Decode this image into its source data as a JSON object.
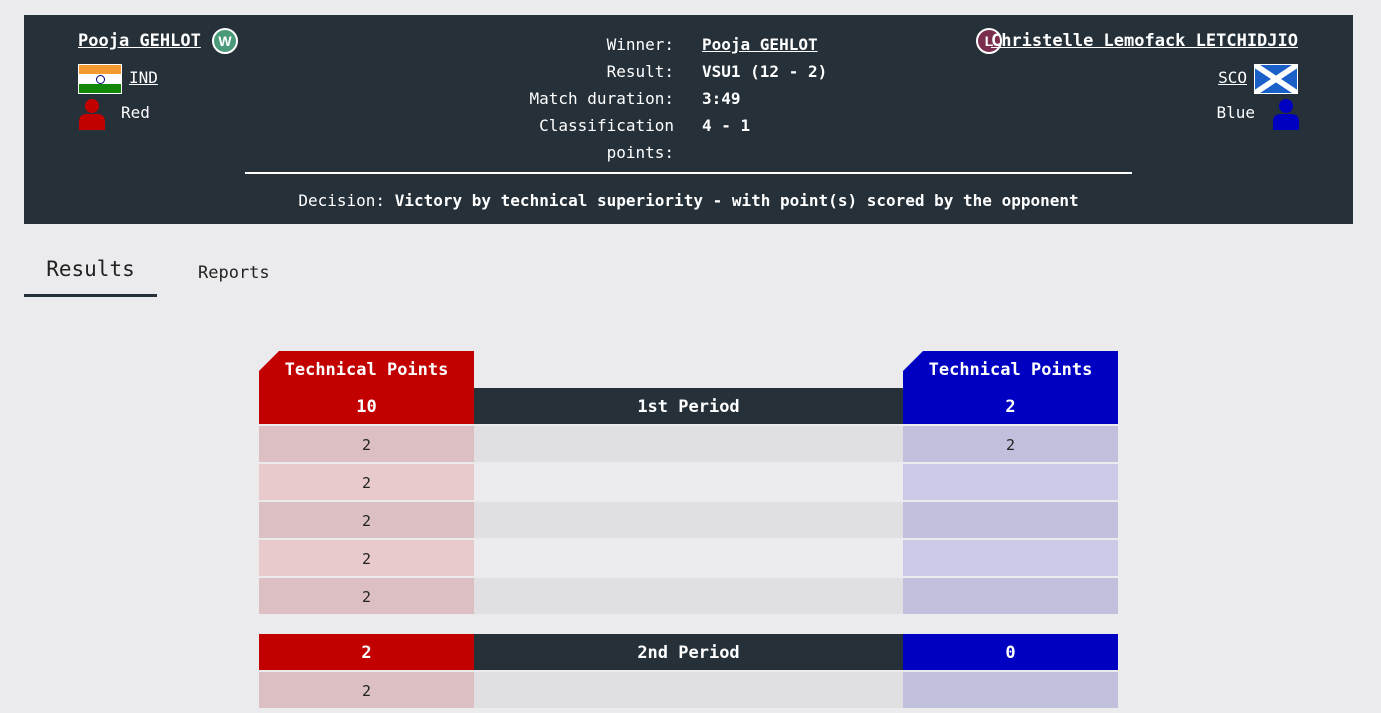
{
  "header": {
    "red": {
      "name": "Pooja GEHLOT",
      "badge": "W",
      "country": "IND",
      "flag_icon": "india-flag",
      "corner": "Red"
    },
    "blue": {
      "name": "Christelle Lemofack LETCHIDJIO",
      "badge": "L",
      "country": "SCO",
      "flag_icon": "scotland-flag",
      "corner": "Blue"
    },
    "summary": {
      "winner_label": "Winner:",
      "winner_value": "Pooja GEHLOT",
      "result_label": "Result:",
      "result_value": "VSU1 (12 - 2)",
      "duration_label": "Match duration:",
      "duration_value": "3:49",
      "class_label_1": "Classification",
      "class_label_2": "points:",
      "class_value": "4 - 1"
    },
    "decision_label": "Decision:",
    "decision_value": "Victory by technical superiority - with point(s) scored by the opponent"
  },
  "tabs": [
    {
      "label": "Results",
      "active": true
    },
    {
      "label": "Reports",
      "active": false
    }
  ],
  "table": {
    "red_header": "Technical Points",
    "blue_header": "Technical Points",
    "periods": [
      {
        "label": "1st Period",
        "red_total": "10",
        "blue_total": "2",
        "rows": [
          {
            "red": "2",
            "blue": "2"
          },
          {
            "red": "2",
            "blue": ""
          },
          {
            "red": "2",
            "blue": ""
          },
          {
            "red": "2",
            "blue": ""
          },
          {
            "red": "2",
            "blue": ""
          }
        ]
      },
      {
        "label": "2nd Period",
        "red_total": "2",
        "blue_total": "0",
        "rows": [
          {
            "red": "2",
            "blue": ""
          }
        ]
      }
    ]
  },
  "colors": {
    "red": "#c20000",
    "blue": "#0000c2",
    "dark": "#253039",
    "winner_badge": "#4a9a7a",
    "loser_badge": "#7b2d4d"
  }
}
